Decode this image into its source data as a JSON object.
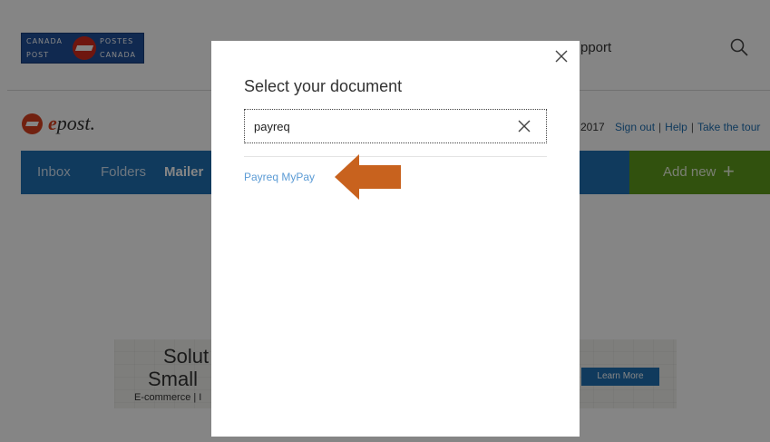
{
  "header": {
    "logo_text": [
      "CANADA",
      "POSTES",
      "POST",
      "CANADA"
    ],
    "support_partial": "pport"
  },
  "epost": {
    "logo_text": "epost",
    "date_partial": "2017",
    "links": [
      "Sign out",
      "Help",
      "Take the tour"
    ]
  },
  "nav": {
    "items": [
      "Inbox",
      "Folders",
      "Mailer"
    ],
    "add_new": "Add new"
  },
  "banner": {
    "line1": "Solut",
    "line2": "Small",
    "line3": "E-commerce  |  I",
    "learn_more": "Learn More"
  },
  "modal": {
    "title": "Select your document",
    "search_value": "payreq",
    "results": [
      "Payreq MyPay"
    ]
  },
  "colors": {
    "nav_blue": "#1f6fb2",
    "add_green": "#5e9b1c",
    "arrow_orange": "#c8621e",
    "result_link": "#5b9bd5"
  }
}
